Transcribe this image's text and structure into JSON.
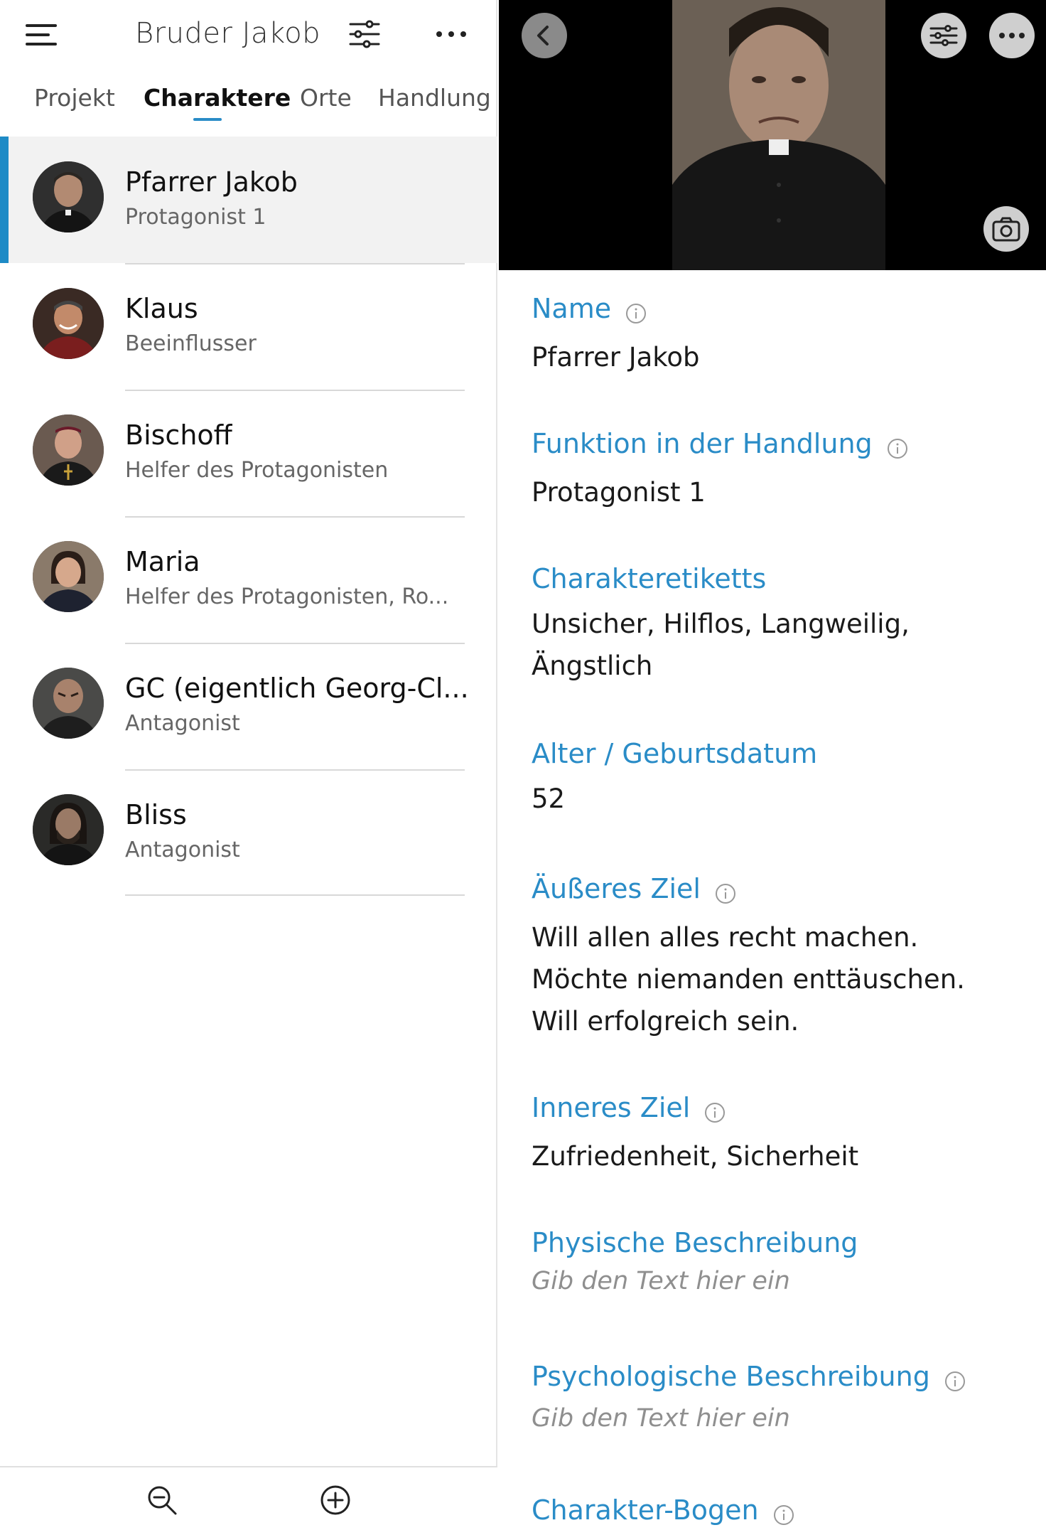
{
  "header": {
    "title": "Bruder Jakob"
  },
  "tabs": [
    {
      "label": "Projekt"
    },
    {
      "label": "Charaktere"
    },
    {
      "label": "Orte"
    },
    {
      "label": "Handlung"
    }
  ],
  "characters": [
    {
      "name": "Pfarrer Jakob",
      "role": "Protagonist 1"
    },
    {
      "name": "Klaus",
      "role": "Beeinflusser"
    },
    {
      "name": "Bischoff",
      "role": "Helfer des Protagonisten"
    },
    {
      "name": "Maria",
      "role": "Helfer des Protagonisten, Ro..."
    },
    {
      "name": "GC (eigentlich Georg-Cl...",
      "role": "Antagonist"
    },
    {
      "name": "Bliss",
      "role": "Antagonist"
    }
  ],
  "detail": {
    "fields": [
      {
        "label": "Name",
        "value": "Pfarrer Jakob"
      },
      {
        "label": "Funktion in der Handlung",
        "value": "Protagonist 1"
      },
      {
        "label": "Charakteretiketts",
        "value": "Unsicher, Hilflos, Langweilig, Ängstlich"
      },
      {
        "label": "Alter / Geburtsdatum",
        "value": "52"
      },
      {
        "label": "Äußeres Ziel",
        "value": "Will allen alles recht machen. Möchte niemanden enttäuschen. Will erfolgreich sein."
      },
      {
        "label": "Inneres Ziel",
        "value": "Zufriedenheit, Sicherheit"
      },
      {
        "label": "Physische Beschreibung",
        "placeholder": "Gib den Text hier ein"
      },
      {
        "label": "Psychologische Beschreibung",
        "placeholder": "Gib den Text hier ein"
      },
      {
        "label": "Charakter-Bogen"
      }
    ]
  },
  "colors": {
    "accent": "#2a8cc7",
    "selection_bar": "#1f8bc6"
  },
  "icons": [
    "menu-icon",
    "filter-icon",
    "more-icon",
    "back-icon",
    "camera-icon",
    "info-icon",
    "zoom-out-icon",
    "add-icon"
  ]
}
